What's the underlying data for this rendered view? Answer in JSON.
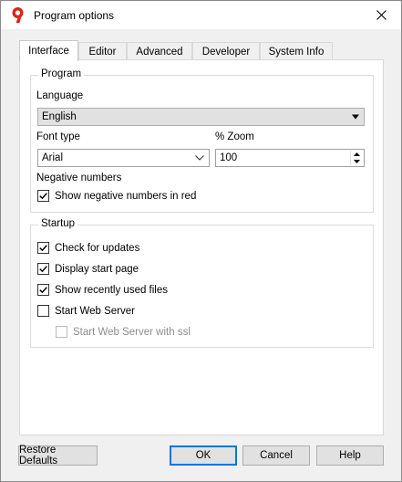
{
  "window": {
    "title": "Program options",
    "logo_glyph": "9"
  },
  "tabs": [
    {
      "label": "Interface",
      "active": true
    },
    {
      "label": "Editor",
      "active": false
    },
    {
      "label": "Advanced",
      "active": false
    },
    {
      "label": "Developer",
      "active": false
    },
    {
      "label": "System Info",
      "active": false
    }
  ],
  "program": {
    "title": "Program",
    "language_label": "Language",
    "language_value": "English",
    "font_label": "Font type",
    "font_value": "Arial",
    "zoom_label": "% Zoom",
    "zoom_value": "100",
    "negative_label": "Negative numbers",
    "show_negative_red": {
      "label": "Show negative numbers in red",
      "checked": true
    }
  },
  "startup": {
    "title": "Startup",
    "check_updates": {
      "label": "Check for updates",
      "checked": true
    },
    "display_start_page": {
      "label": "Display start page",
      "checked": true
    },
    "show_recent_files": {
      "label": "Show recently used files",
      "checked": true
    },
    "start_web_server": {
      "label": "Start Web Server",
      "checked": false
    },
    "start_web_server_ssl": {
      "label": "Start Web Server with ssl",
      "checked": false,
      "disabled": true
    }
  },
  "buttons": {
    "restore_defaults": "Restore Defaults",
    "ok": "OK",
    "cancel": "Cancel",
    "help": "Help"
  },
  "colors": {
    "accent": "#0078d7",
    "logo_red": "#d9251c"
  },
  "icons": {
    "logo": "app-logo-icon",
    "close": "close-icon",
    "dropdown": "chevron-down-icon",
    "check": "checkmark-icon"
  }
}
